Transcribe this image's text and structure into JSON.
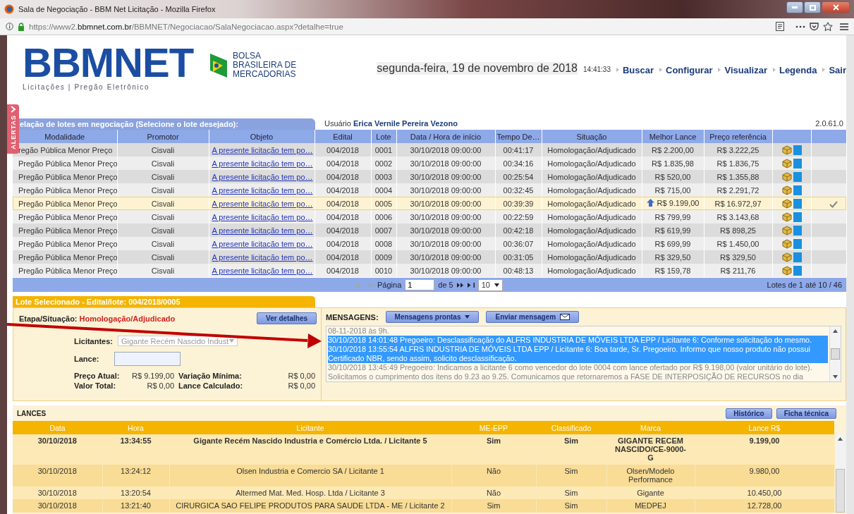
{
  "window": {
    "title": "Sala de Negociação - BBM Net Licitação - Mozilla Firefox",
    "url": "https://www2.**bbmnet.com.br**/BBMNET/Negociacao/SalaNegociacao.aspx?detalhe=true"
  },
  "header": {
    "logo": "BBMNET",
    "tagline": "Licitações | Pregão Eletrônico",
    "partner_lines": [
      "BOLSA",
      "BRASILEIRA DE",
      "MERCADORIAS"
    ],
    "date": "segunda-feira, 19 de novembro de 2018",
    "time": "14:41:33",
    "links": [
      "Buscar",
      "Configurar",
      "Visualizar",
      "Legenda",
      "Sair"
    ]
  },
  "alerts_tab": {
    "label": "ALERTAS"
  },
  "lots": {
    "caption": "elação de lotes em negociação (Selecione o lote desejado):",
    "user_label": "Usuário",
    "user_name": "Erica Vernile Pereira Vezono",
    "version": "2.0.61.0",
    "columns": [
      "Modalidade",
      "Promotor",
      "Objeto",
      "Edital",
      "Lote",
      "Data / Hora de início",
      "Tempo De…",
      "Situação",
      "Melhor Lance",
      "Preço referência"
    ],
    "rows": [
      {
        "cells": [
          "regão Pública Menor Preço",
          "Cisvali",
          "A presente licitação tem po…",
          "004/2018",
          "0001",
          "30/10/2018 09:00:00",
          "00:41:17",
          "Homologação/Adjudicado",
          "R$ 2.200,00",
          "R$ 3.222,25"
        ],
        "selected": false
      },
      {
        "cells": [
          "Pregão Pública Menor Preço",
          "Cisvali",
          "A presente licitação tem po…",
          "004/2018",
          "0002",
          "30/10/2018 09:00:00",
          "00:34:16",
          "Homologação/Adjudicado",
          "R$ 1.835,98",
          "R$ 1.836,75"
        ],
        "selected": false
      },
      {
        "cells": [
          "Pregão Pública Menor Preço",
          "Cisvali",
          "A presente licitação tem po…",
          "004/2018",
          "0003",
          "30/10/2018 09:00:00",
          "00:25:54",
          "Homologação/Adjudicado",
          "R$ 520,00",
          "R$ 1.355,88"
        ],
        "selected": false
      },
      {
        "cells": [
          "Pregão Pública Menor Preço",
          "Cisvali",
          "A presente licitação tem po…",
          "004/2018",
          "0004",
          "30/10/2018 09:00:00",
          "00:32:45",
          "Homologação/Adjudicado",
          "R$ 715,00",
          "R$ 2.291,72"
        ],
        "selected": false
      },
      {
        "cells": [
          "Pregão Pública Menor Preço",
          "Cisvali",
          "A presente licitação tem po…",
          "004/2018",
          "0005",
          "30/10/2018 09:00:00",
          "00:39:39",
          "Homologação/Adjudicado",
          "R$ 9.199,00",
          "R$ 16.972,97"
        ],
        "selected": true
      },
      {
        "cells": [
          "Pregão Pública Menor Preço",
          "Cisvali",
          "A presente licitação tem po…",
          "004/2018",
          "0006",
          "30/10/2018 09:00:00",
          "00:22:59",
          "Homologação/Adjudicado",
          "R$ 799,99",
          "R$ 3.143,68"
        ],
        "selected": false
      },
      {
        "cells": [
          "Pregão Pública Menor Preço",
          "Cisvali",
          "A presente licitação tem po…",
          "004/2018",
          "0007",
          "30/10/2018 09:00:00",
          "00:42:18",
          "Homologação/Adjudicado",
          "R$ 619,99",
          "R$ 898,25"
        ],
        "selected": false
      },
      {
        "cells": [
          "Pregão Pública Menor Preço",
          "Cisvali",
          "A presente licitação tem po…",
          "004/2018",
          "0008",
          "30/10/2018 09:00:00",
          "00:36:07",
          "Homologação/Adjudicado",
          "R$ 699,99",
          "R$ 1.450,00"
        ],
        "selected": false
      },
      {
        "cells": [
          "Pregão Pública Menor Preço",
          "Cisvali",
          "A presente licitação tem po…",
          "004/2018",
          "0009",
          "30/10/2018 09:00:00",
          "00:31:05",
          "Homologação/Adjudicado",
          "R$ 329,50",
          "R$ 329,50"
        ],
        "selected": false
      },
      {
        "cells": [
          "Pregão Pública Menor Preço",
          "Cisvali",
          "A presente licitação tem po…",
          "004/2018",
          "0010",
          "30/10/2018 09:00:00",
          "00:48:13",
          "Homologação/Adjudicado",
          "R$ 159,78",
          "R$ 211,76"
        ],
        "selected": false
      }
    ]
  },
  "pager": {
    "page_label": "Página",
    "page": "1",
    "of": "de 5",
    "per_page": "10",
    "summary": "Lotes de 1 até 10 / 46"
  },
  "selected_lot": {
    "tab": "Lote Selecionado - Edital/lote: 004/2018/0005",
    "stage_label": "Etapa/Situação:",
    "stage": "Homologação/Adjudicado",
    "details_button": "Ver detalhes",
    "bidders_label": "Licitantes:",
    "bidder": "Gigante Recém Nascido Indust",
    "bid_label": "Lance:",
    "fields": [
      {
        "label": "Preço Atual:",
        "value": "R$ 9.199,00"
      },
      {
        "label": "Variação Mínima:",
        "value": "R$ 0,00"
      },
      {
        "label": "Valor Total:",
        "value": "R$ 0,00"
      },
      {
        "label": "Lance Calculado:",
        "value": "R$ 0,00"
      }
    ]
  },
  "messages": {
    "label": "MENSAGENS:",
    "ready_button": "Mensagens prontas",
    "send_button": "Enviar mensagem",
    "items": [
      {
        "text": "08-11-2018 às 9h.",
        "selected": false
      },
      {
        "text": "30/10/2018 14:01:48 Pregoeiro: Desclassificação do ALFRS INDUSTRIA DE MÓVEIS LTDA EPP / Licitante 6: Conforme solicitação do mesmo.",
        "selected": true
      },
      {
        "text": "30/10/2018 13:55:54 ALFRS INDUSTRIA DE MÓVEIS LTDA EPP / Licitante 6: Boa tarde, Sr. Pregoeiro. Informo que nosso produto não possui Certificado NBR, sendo assim, solicito desclassificação.",
        "selected": true
      },
      {
        "text": "30/10/2018 13:45:49 Pregoeiro: Indicamos a licitante 6 como vencedor do lote 0004 com lance ofertado por R$ 9.198,00 (valor unitário do lote). Solicitamos o cumprimento dos itens do 9.23 ao 9.25. Comunicamos que retornaremos a FASE DE INTERPOSIÇÃO DE RECURSOS no dia",
        "selected": false
      }
    ]
  },
  "lances": {
    "title": "LANCES",
    "buttons": [
      "Histórico",
      "Ficha técnica"
    ],
    "columns": [
      "Data",
      "Hora",
      "Licitante",
      "ME-EPP",
      "Classificado",
      "Marca",
      "Lance R$"
    ],
    "rows": [
      {
        "cells": [
          "30/10/2018",
          "13:34:55",
          "Gigante Recém Nascido Industria e Comércio Ltda. / Licitante 5",
          "Sim",
          "Sim",
          "GIGANTE RECEM NASCIDO/CE-9000-G",
          "9.199,00"
        ],
        "leading": true
      },
      {
        "cells": [
          "30/10/2018",
          "13:24:12",
          "Olsen Industria e Comercio SA / Licitante 1",
          "Não",
          "Sim",
          "Olsen/Modelo Performance",
          "9.980,00"
        ],
        "leading": false
      },
      {
        "cells": [
          "30/10/2018",
          "13:20:54",
          "Altermed Mat. Med. Hosp. Ltda / Licitante 3",
          "Não",
          "Sim",
          "Gigante",
          "10.450,00"
        ],
        "leading": false
      },
      {
        "cells": [
          "30/10/2018",
          "13:21:40",
          "CIRURGICA SAO FELIPE PRODUTOS PARA SAUDE LTDA - ME / Licitante 2",
          "Sim",
          "Sim",
          "MEDPEJ",
          "12.728,00"
        ],
        "leading": false
      }
    ]
  }
}
